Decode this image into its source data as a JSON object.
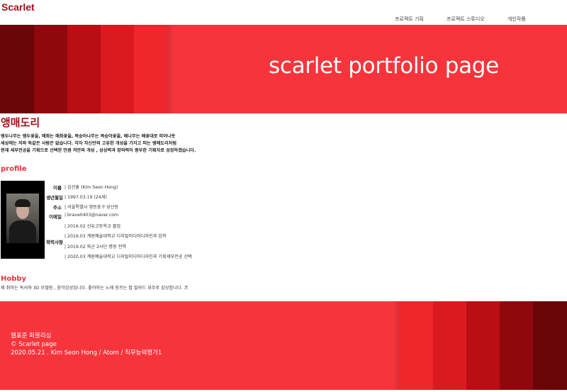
{
  "header": {
    "logo": "Scarlet",
    "nav": [
      "프로젝트 기획",
      "프로젝트 스튜디오",
      "개인작품"
    ]
  },
  "hero": {
    "title": "scarlet portfolio page",
    "stripe_colors": [
      "#6a0508",
      "#8e080d",
      "#b80e14",
      "#db1a20",
      "#f0262c"
    ]
  },
  "intro": {
    "title": "앵매도리",
    "lines": [
      "앵두나무는 앵두꽃을, 매화는 매화꽃을, 복숭아나무는 복숭아꽃을, 배나무는 배꽃대로 피어나듯",
      "세상에는 저와 똑같은 사람은 없습니다. 각자 자신만의 고유한 개성을 가지고 피는 앵매도리처럼",
      "현재 세부전공을 기획으로 선택한 만큼 저만의 개성 , 상상력과 창의력이 풍부한 기획자로 성장하겠습니다."
    ]
  },
  "profile": {
    "title": "profile",
    "rows": [
      {
        "label": "이름",
        "value": "| 김선홍 (Kim Seon Hong)"
      },
      {
        "label": "생년월일",
        "value": "| 1997.03.19 (24세)"
      },
      {
        "label": "주소",
        "value": "| 서울특별시 영등포구 당산동"
      },
      {
        "label": "이메일",
        "value": "| brave0403@naver.com"
      }
    ],
    "history_label": "학력사항",
    "history": [
      "| 2016.02 선유고등학교 졸업",
      "| 2016.03 계원예술대학교 디지털미디어디자인과 입학",
      "| 2019.02 육군 2사단 병장 전역",
      "| 2020.03 계원예술대학교 디지털미디어디자인과 기획세부전공 선택"
    ]
  },
  "hobby": {
    "title": "Hobby",
    "text": "제 취미는 독서와 3D 모델링 , 음악감상입니다. 좋아하는 노래 장르는 팝 발라드 위주로 감상합니다. ♬"
  },
  "footer": {
    "lines": [
      "웹표준 퍼블리싱",
      "© Scarlet page",
      "2020.05.21 . Kim Seon Hong / Atom / 직무능력평가1"
    ],
    "stripe_colors": [
      "#f0262c",
      "#db1a20",
      "#b80e14",
      "#8e080d",
      "#6a0508"
    ]
  },
  "colors": {
    "accent": "#a0101a",
    "banner": "#f7343c"
  }
}
